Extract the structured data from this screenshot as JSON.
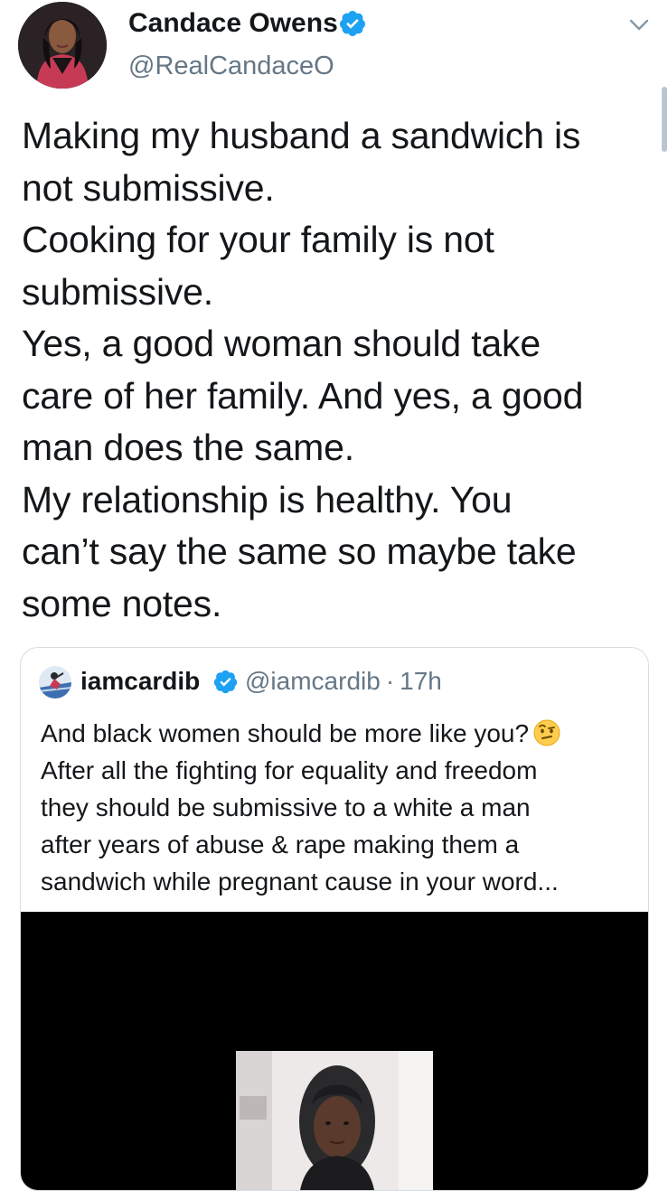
{
  "tweet": {
    "author_name": "Candace Owens",
    "author_handle": "@RealCandaceO",
    "verified": true,
    "text_lines": [
      "Making my husband a sandwich is",
      "not submissive.",
      "Cooking for your family is not",
      "submissive.",
      "Yes, a good woman should take",
      "care of her family. And yes, a good",
      "man does the same.",
      "My relationship is healthy. You",
      "can’t say the same so maybe take",
      "some notes."
    ]
  },
  "quoted_tweet": {
    "author_name": "iamcardib",
    "verified": true,
    "author_handle": "@iamcardib",
    "separator": "·",
    "time": "17h",
    "text_lines": [
      "And black women should be more like you?",
      "After all the fighting for equality and freedom",
      "they should be submissive to a white a man",
      "after years of abuse & rape  making them a",
      "sandwich while pregnant cause in your word..."
    ],
    "emoji": "face-with-raised-eyebrow"
  },
  "colors": {
    "text": "#14171a",
    "secondary_text": "#657786",
    "verified_blue": "#1da1f2",
    "border": "#d7dee3",
    "media_background": "#000000"
  },
  "icons": [
    "verified-badge-icon",
    "chevron-down-icon",
    "face-with-raised-eyebrow-emoji"
  ]
}
